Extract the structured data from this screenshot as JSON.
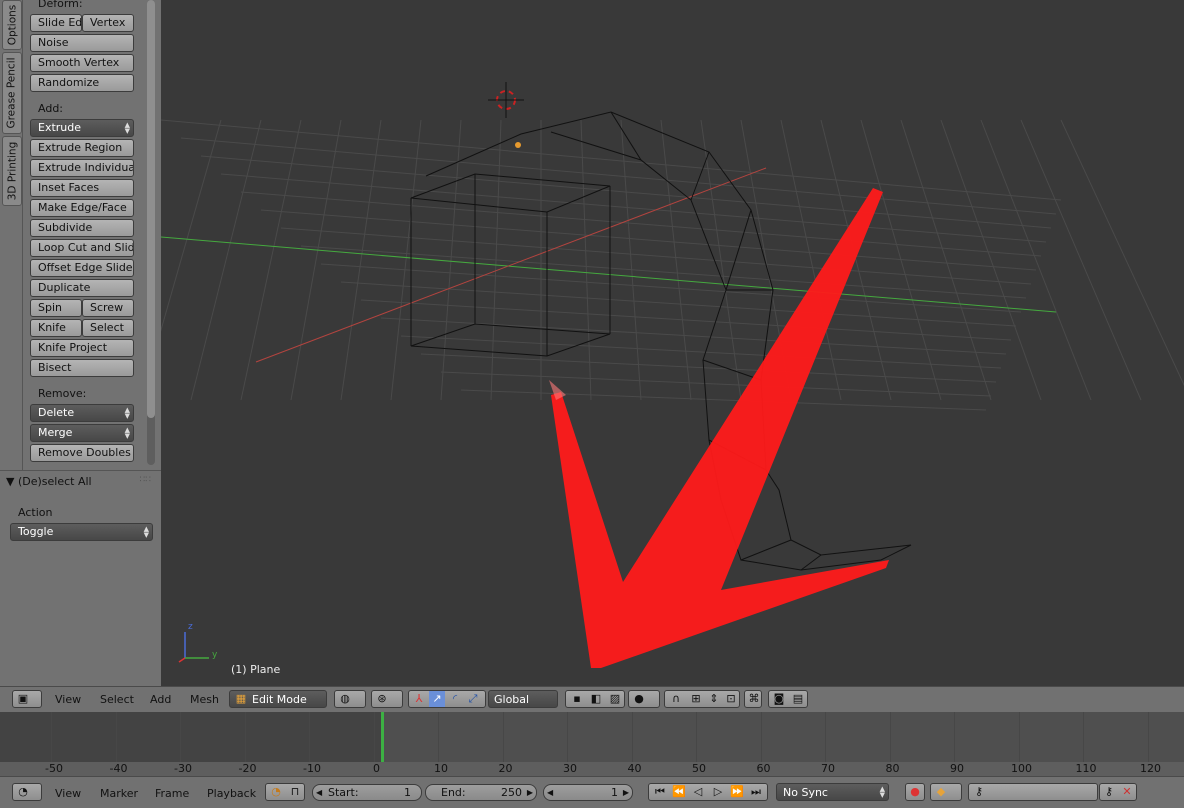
{
  "tabs": [
    "Options",
    "Grease Pencil",
    "3D Printing"
  ],
  "tools": {
    "deform_label": "Deform:",
    "slide_edge": "Slide Ed",
    "vertex": "Vertex",
    "noise": "Noise",
    "smooth_vertex": "Smooth Vertex",
    "randomize": "Randomize",
    "add_label": "Add:",
    "extrude": "Extrude",
    "extrude_region": "Extrude Region",
    "extrude_individual": "Extrude Individual",
    "inset_faces": "Inset Faces",
    "make_edge_face": "Make Edge/Face",
    "subdivide": "Subdivide",
    "loop_cut": "Loop Cut and Slide",
    "offset_edge": "Offset Edge Slide",
    "duplicate": "Duplicate",
    "spin": "Spin",
    "screw": "Screw",
    "knife": "Knife",
    "select": "Select",
    "knife_project": "Knife Project",
    "bisect": "Bisect",
    "remove_label": "Remove:",
    "delete": "Delete",
    "merge": "Merge",
    "remove_doubles": "Remove Doubles"
  },
  "operator": {
    "title": "(De)select All",
    "action_label": "Action",
    "action_value": "Toggle"
  },
  "viewport": {
    "object_label": "(1) Plane",
    "axis_z": "z",
    "axis_y": "y"
  },
  "header3d": {
    "view": "View",
    "select": "Select",
    "add": "Add",
    "mesh": "Mesh",
    "mode": "Edit Mode",
    "orientation": "Global"
  },
  "timeline": {
    "ruler": [
      "-50",
      "-40",
      "-30",
      "-20",
      "-10",
      "0",
      "10",
      "20",
      "30",
      "40",
      "50",
      "60",
      "70",
      "80",
      "90",
      "100",
      "110",
      "120"
    ],
    "current_frame": 0
  },
  "footer": {
    "view": "View",
    "marker": "Marker",
    "frame": "Frame",
    "playback": "Playback",
    "start_label": "Start:",
    "start_value": "1",
    "end_label": "End:",
    "end_value": "250",
    "current": "1",
    "sync": "No Sync"
  },
  "colors": {
    "grid_x_axis": "#b3443f",
    "grid_y_axis": "#45a93f",
    "annotation": "#ff1a1a",
    "frame_cursor": "#3cb043"
  }
}
